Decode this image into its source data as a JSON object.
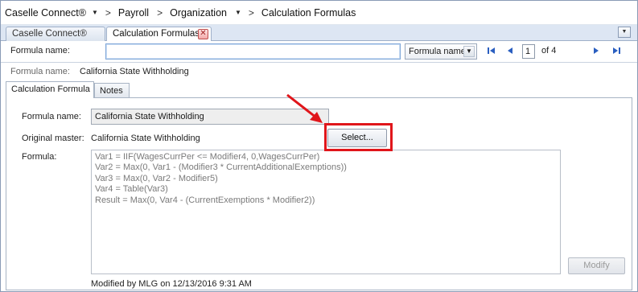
{
  "breadcrumb": {
    "items": [
      "Caselle Connect®",
      "Payroll",
      "Organization",
      "Calculation Formulas"
    ]
  },
  "doc_tabs": {
    "tab1": "Caselle Connect®",
    "tab2": "Calculation Formulas",
    "close_glyph": "✕",
    "overflow_glyph": "▼"
  },
  "search": {
    "label": "Formula name:",
    "value": "",
    "filter_selected": "Formula name",
    "page_current": "1",
    "page_of": "of 4"
  },
  "info": {
    "label": "Formula name:",
    "value": "California State Withholding"
  },
  "tabs": {
    "calc": "Calculation Formula",
    "notes": "Notes"
  },
  "form": {
    "name_label": "Formula name:",
    "name_value": "California State Withholding",
    "master_label": "Original master:",
    "master_value": "California State Withholding",
    "select_button": "Select...",
    "formula_label": "Formula:",
    "formula_lines": [
      "Var1 = IIF(WagesCurrPer <= Modifier4, 0,WagesCurrPer)",
      "Var2 = Max(0, Var1 - (Modifier3 * CurrentAdditionalExemptions))",
      "Var3 = Max(0, Var2 - Modifier5)",
      "Var4 = Table(Var3)",
      "Result = Max(0, Var4 - (CurrentExemptions * Modifier2))"
    ],
    "modify_button": "Modify",
    "modified_text": "Modified by MLG on 12/13/2016 9:31 AM"
  },
  "icons": {
    "dropdown": "chevron-down-icon",
    "first": "first-page-icon",
    "prev": "previous-page-icon",
    "next": "next-page-icon",
    "last": "last-page-icon",
    "close": "close-icon",
    "annotation_arrow": "red-arrow-icon"
  },
  "colors": {
    "highlight": "#e0161b",
    "nav_blue": "#2a5ec0",
    "tab_strip": "#dde6f3"
  }
}
